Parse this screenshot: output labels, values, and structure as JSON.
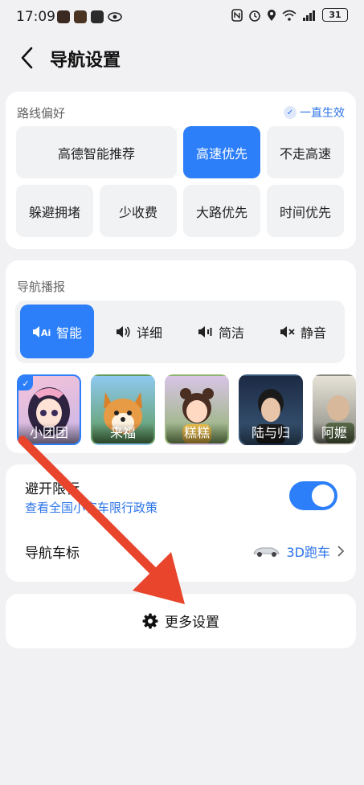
{
  "status_bar": {
    "time": "17:09",
    "battery": "31"
  },
  "header": {
    "title": "导航设置"
  },
  "route_pref": {
    "section_title": "路线偏好",
    "always_effective": "一直生效",
    "options": [
      "高德智能推荐",
      "高速优先",
      "不走高速",
      "躲避拥堵",
      "少收费",
      "大路优先",
      "时间优先"
    ],
    "selected": "高速优先"
  },
  "broadcast": {
    "section_title": "导航播报",
    "modes": [
      {
        "label": "智能",
        "icon": "ai-speaker-icon"
      },
      {
        "label": "详细",
        "icon": "speaker-loud-icon"
      },
      {
        "label": "简洁",
        "icon": "speaker-low-icon"
      },
      {
        "label": "静音",
        "icon": "speaker-mute-icon"
      }
    ],
    "selected_mode": "智能",
    "voices": [
      "小团团",
      "来福",
      "糕糕",
      "陆与归",
      "阿嬷"
    ],
    "selected_voice": "小团团"
  },
  "restrictions": {
    "label": "避开限行",
    "sub_link": "查看全国小客车限行政策",
    "toggle_on": true
  },
  "car_icon": {
    "label": "导航车标",
    "value": "3D跑车"
  },
  "more_settings": {
    "label": "更多设置"
  },
  "colors": {
    "accent": "#2d7ff9",
    "annotation_arrow": "#e8452c"
  }
}
